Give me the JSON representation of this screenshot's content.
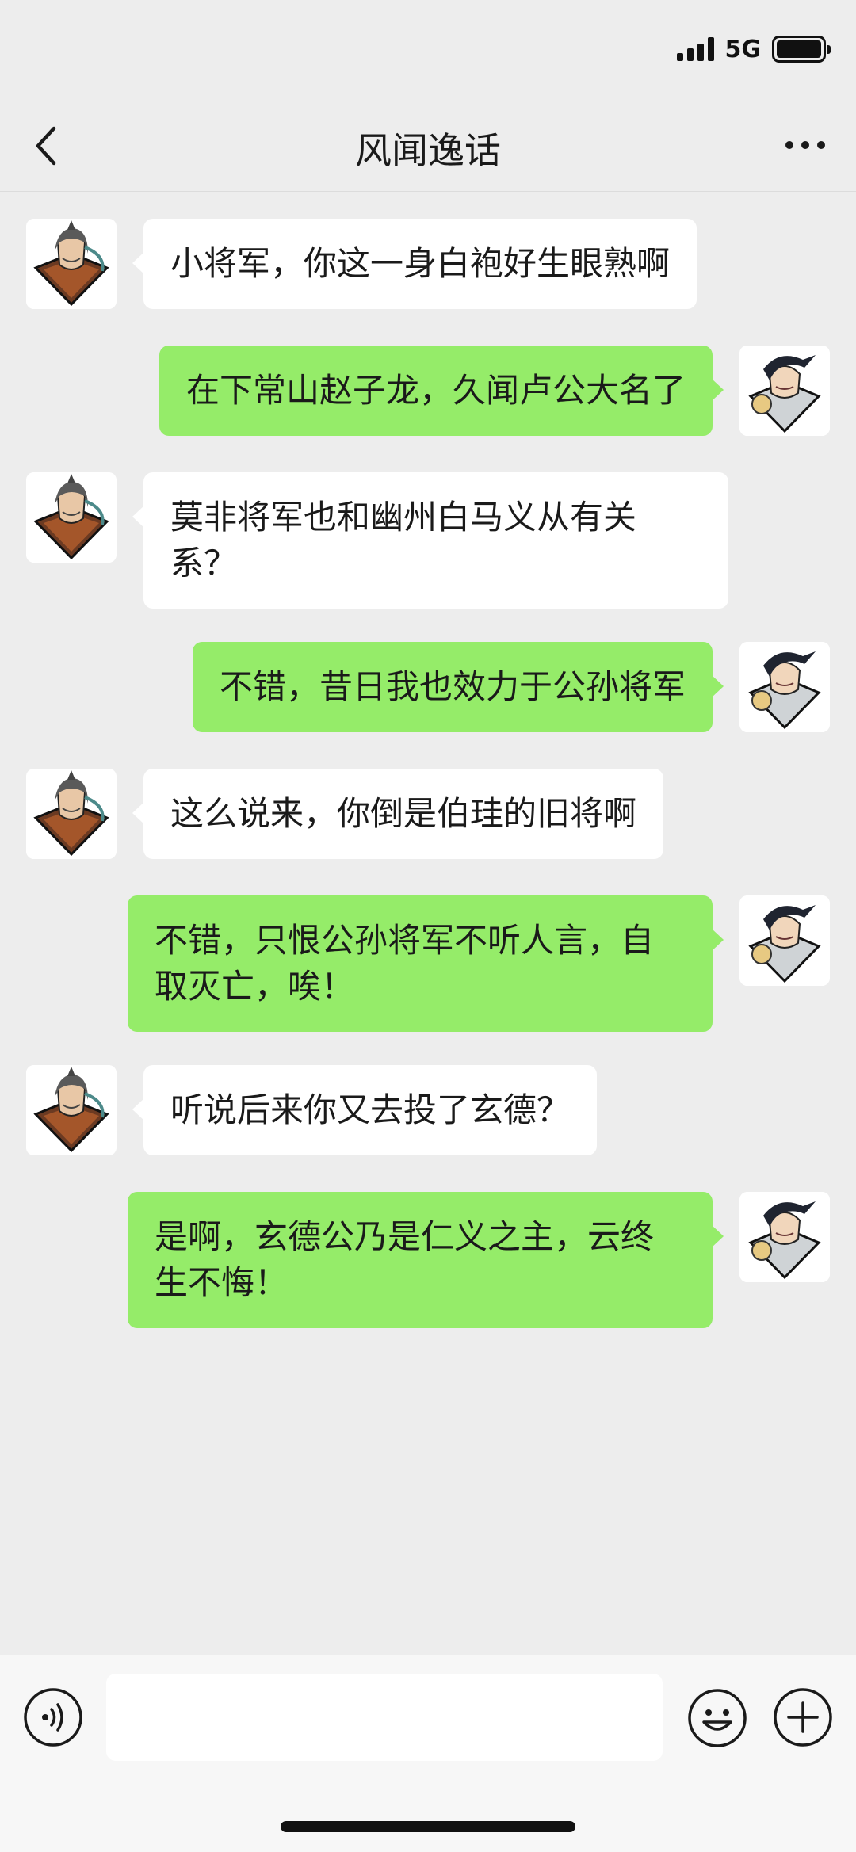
{
  "status": {
    "network": "5G"
  },
  "header": {
    "title": "风闻逸话"
  },
  "messages": [
    {
      "side": "left",
      "text": "小将军，你这一身白袍好生眼熟啊"
    },
    {
      "side": "right",
      "text": "在下常山赵子龙，久闻卢公大名了"
    },
    {
      "side": "left",
      "text": "莫非将军也和幽州白马义从有关系？"
    },
    {
      "side": "right",
      "text": "不错，昔日我也效力于公孙将军"
    },
    {
      "side": "left",
      "text": "这么说来，你倒是伯珪的旧将啊"
    },
    {
      "side": "right",
      "text": "不错，只恨公孙将军不听人言，自取灭亡，唉！"
    },
    {
      "side": "left",
      "text": "听说后来你又去投了玄德？"
    },
    {
      "side": "right",
      "text": "是啊，玄德公乃是仁义之主，云终生不悔！"
    }
  ],
  "input": {
    "value": ""
  },
  "colors": {
    "bubble_right": "#95ec69",
    "bubble_left": "#ffffff",
    "background": "#ededed"
  }
}
